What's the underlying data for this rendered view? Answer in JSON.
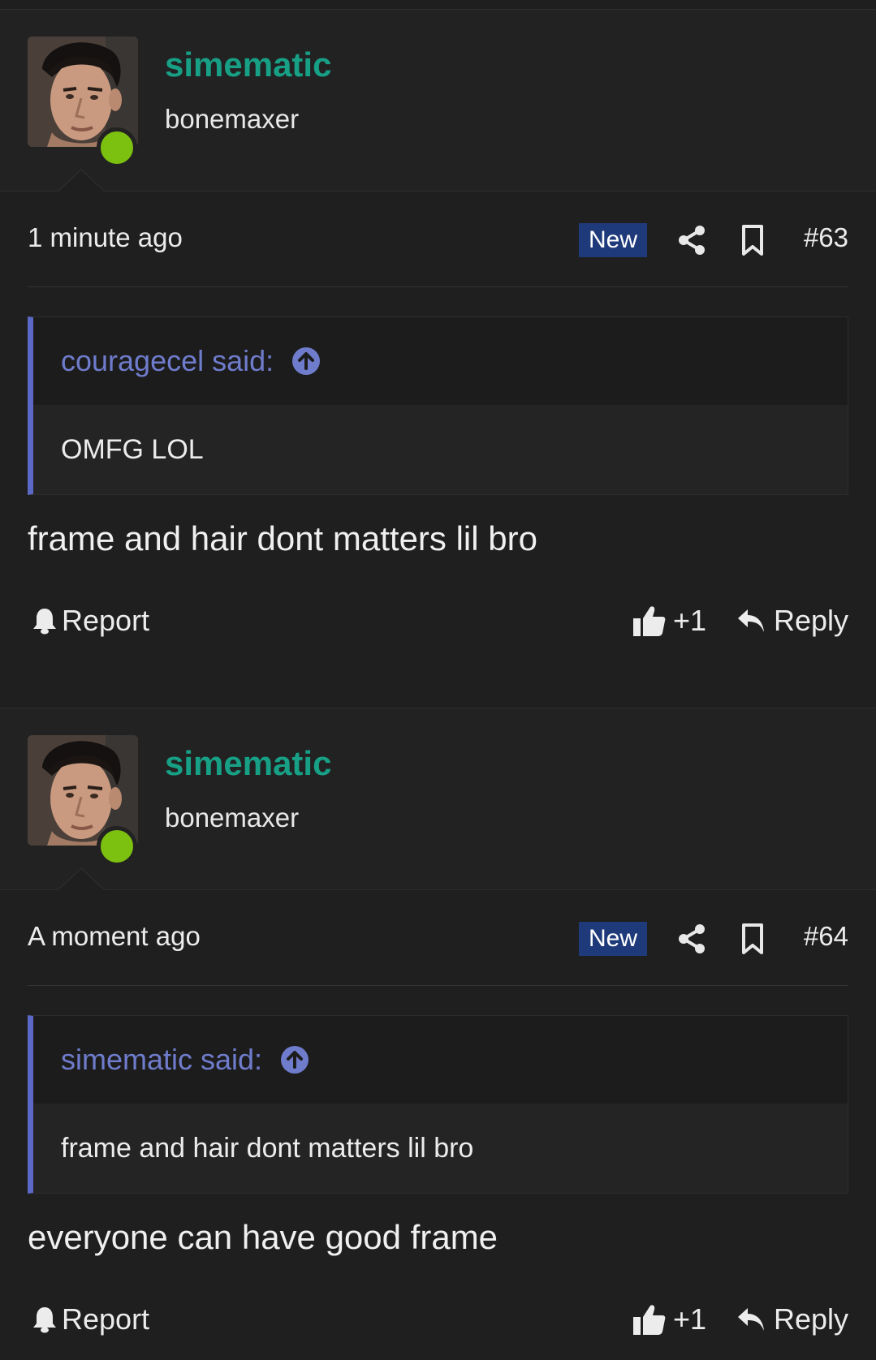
{
  "posts": [
    {
      "username": "simematic",
      "user_title": "bonemaxer",
      "timestamp": "1 minute ago",
      "badge": "New",
      "post_number": "#63",
      "quote": {
        "author": "couragecel said:",
        "text": "OMFG LOL"
      },
      "message": "frame and hair dont matters lil bro",
      "actions": {
        "report": "Report",
        "like": "+1",
        "reply": "Reply"
      }
    },
    {
      "username": "simematic",
      "user_title": "bonemaxer",
      "timestamp": "A moment ago",
      "badge": "New",
      "post_number": "#64",
      "quote": {
        "author": "simematic said:",
        "text": "frame and hair dont matters lil bro"
      },
      "message": "everyone can have good frame",
      "actions": {
        "report": "Report",
        "like": "+1",
        "reply": "Reply"
      }
    }
  ],
  "colors": {
    "background": "#1f1f1f",
    "username": "#17a085",
    "online": "#7cc110",
    "badge": "#1f3a7a",
    "quote_accent": "#5b68c6",
    "quote_author": "#6f7ccc"
  },
  "icons": [
    "share-icon",
    "bookmark-icon",
    "arrow-up-circle-icon",
    "bell-icon",
    "thumbs-up-icon",
    "reply-icon"
  ]
}
